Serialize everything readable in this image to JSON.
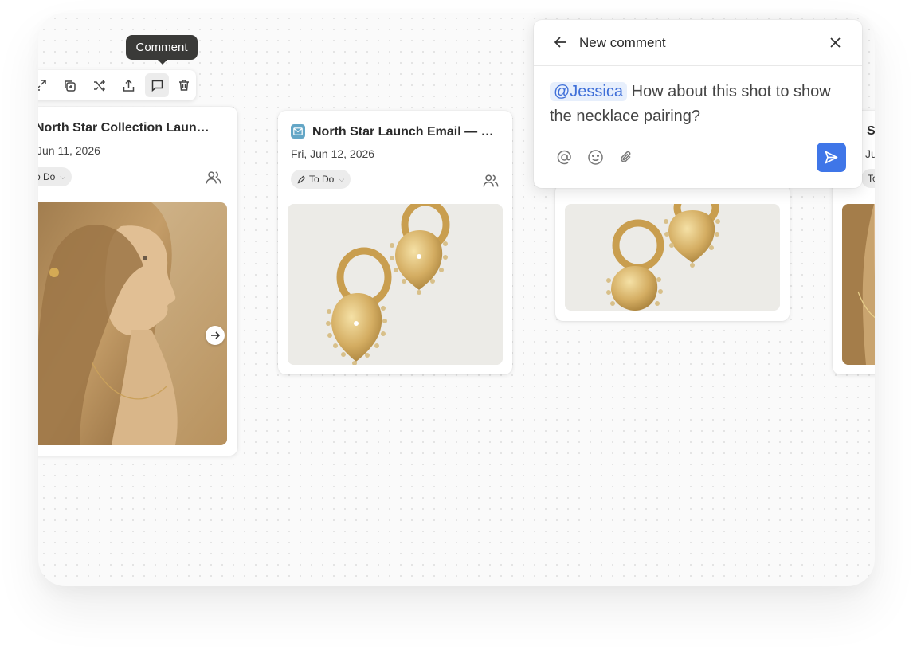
{
  "toolbar": {
    "tooltip": "Comment",
    "buttons": [
      {
        "icon": "expand-icon"
      },
      {
        "icon": "duplicate-icon"
      },
      {
        "icon": "shuffle-icon"
      },
      {
        "icon": "share-icon"
      },
      {
        "icon": "comment-icon",
        "active": true
      },
      {
        "icon": "trash-icon"
      }
    ]
  },
  "cards": [
    {
      "title": "North Star Collection Laun…",
      "date": "Jun 11, 2026",
      "status": "o Do",
      "image": "woman-portrait-image",
      "has_next": true
    },
    {
      "title": "North Star Launch Email — …",
      "date": "Fri, Jun 12, 2026",
      "status": "To Do",
      "image": "earrings-image",
      "icon": "email-icon"
    },
    {
      "image": "earrings-image-cropped"
    },
    {
      "title": "S",
      "date": "Ju",
      "status": "To",
      "image": "necklace-portrait-image"
    }
  ],
  "comment": {
    "title": "New comment",
    "mention": "@Jessica",
    "text": "How about this shot to show the necklace pairing?",
    "icons": [
      "at-sign-icon",
      "emoji-icon",
      "attachment-icon"
    ],
    "accent": "#3f76e8"
  }
}
